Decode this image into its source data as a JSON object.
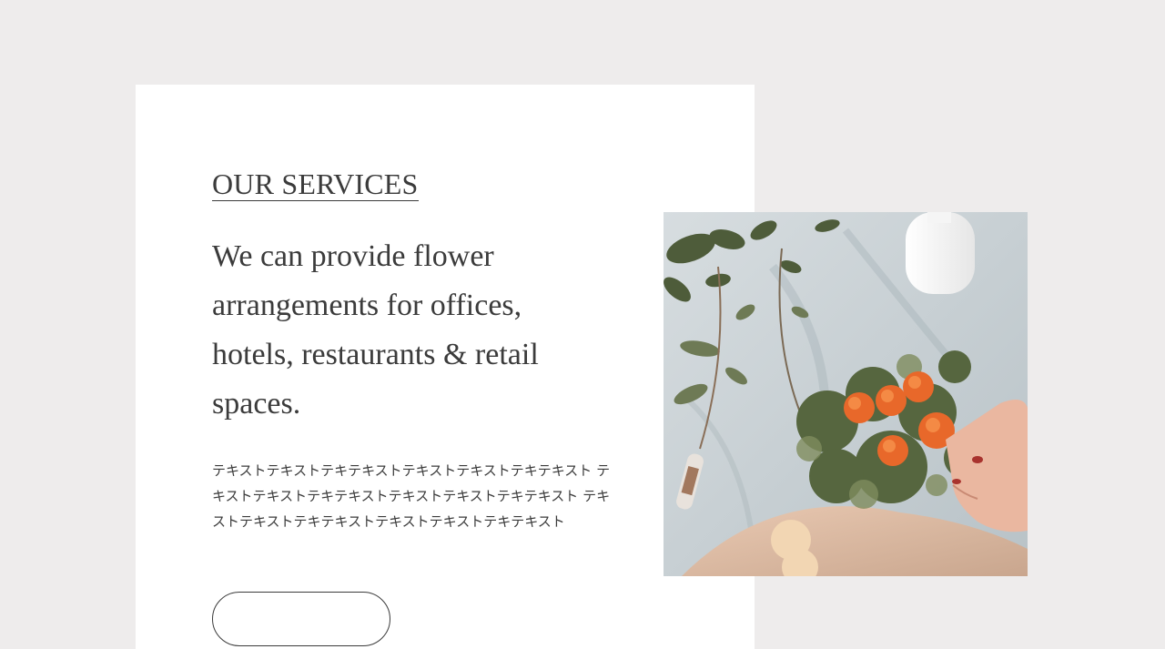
{
  "services": {
    "title": "OUR SERVICES",
    "lead": "We can provide flower arrangements for offices, hotels, restaurants & retail spaces.",
    "body": "テキストテキストテキテキストテキストテキストテキテキスト テキストテキストテキテキストテキストテキストテキテキスト テキストテキストテキテキストテキストテキストテキテキスト",
    "button_label": ""
  },
  "colors": {
    "page_background": "#eeecec",
    "card_background": "#ffffff",
    "text": "#3b3b3b",
    "flower_accent": "#e8682a"
  }
}
